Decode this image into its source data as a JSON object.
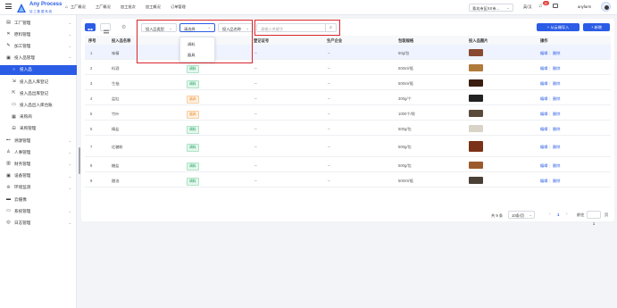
{
  "app": {
    "logo_title": "Any Process",
    "logo_sub": "加 工 数 据 系 统"
  },
  "topnav": {
    "items": [
      "工厂概况",
      "工厂概况",
      "加工批次",
      "加工概况",
      "订单管理"
    ],
    "factory_select": "青岛市区XX市…",
    "lang": "英/汉",
    "bell_count": "10",
    "user": "anyfarm"
  },
  "sidebar": {
    "items": [
      {
        "label": "工厂管理",
        "icon": "factory-icon",
        "chevron": "⌄"
      },
      {
        "label": "原料管理",
        "icon": "close-x-icon",
        "chevron": "⌄"
      },
      {
        "label": "加工管理",
        "icon": "tools-icon",
        "chevron": "⌄"
      },
      {
        "label": "投入品管理",
        "icon": "box-icon",
        "chevron": "⌃"
      },
      {
        "label": "投入品",
        "icon": "circle-icon",
        "chevron": "",
        "sub": true,
        "active": true
      },
      {
        "label": "投入品入库登记",
        "icon": "inbound-icon",
        "chevron": "",
        "sub": true
      },
      {
        "label": "投入品出库登记",
        "icon": "outbound-icon",
        "chevron": "",
        "sub": true
      },
      {
        "label": "投入品出入库台账",
        "icon": "ledger-icon",
        "chevron": "",
        "sub": true
      },
      {
        "label": "采购商",
        "icon": "store-icon",
        "chevron": "",
        "sub": true
      },
      {
        "label": "采购管理",
        "icon": "cart-icon",
        "chevron": "",
        "sub": true
      },
      {
        "label": "溯源管理",
        "icon": "trace-icon",
        "chevron": "⌄"
      },
      {
        "label": "人事管理",
        "icon": "person-icon",
        "chevron": "⌄"
      },
      {
        "label": "财务管理",
        "icon": "finance-icon",
        "chevron": "⌄"
      },
      {
        "label": "设备管理",
        "icon": "device-icon",
        "chevron": "⌄"
      },
      {
        "label": "环境监测",
        "icon": "gear-icon",
        "chevron": "⌄"
      },
      {
        "label": "云摄像",
        "icon": "camera-icon",
        "chevron": ""
      },
      {
        "label": "系统管理",
        "icon": "monitor-icon",
        "chevron": "⌄"
      },
      {
        "label": "日志管理",
        "icon": "log-icon",
        "chevron": "⌄"
      }
    ]
  },
  "toolbar": {
    "type_select": "投入品类型",
    "value_select": "请选择",
    "name_select": "投入品名称",
    "search_placeholder": "请输入关键字",
    "import_btn": "+ 从云端导入",
    "add_btn": "+ 新增",
    "dropdown_options": [
      "调料",
      "器具"
    ]
  },
  "table": {
    "headers": [
      "序号",
      "投入品名称",
      "",
      "登记证号",
      "生产企业",
      "包装规格",
      "投入品图片",
      "操作"
    ],
    "rows": [
      {
        "no": "1",
        "name": "味精",
        "tag": "调料",
        "tag_color": "green",
        "reg": "--",
        "maker": "--",
        "spec": "50g/包",
        "img": "#8a4a32"
      },
      {
        "no": "2",
        "name": "料酒",
        "tag": "调料",
        "tag_color": "green",
        "reg": "--",
        "maker": "--",
        "spec": "500ml/瓶",
        "img": "#b07a3a"
      },
      {
        "no": "3",
        "name": "生抽",
        "tag": "调料",
        "tag_color": "green",
        "reg": "--",
        "maker": "--",
        "spec": "500ml/瓶",
        "img": "#3a1d10"
      },
      {
        "no": "4",
        "name": "盆缸",
        "tag": "器具",
        "tag_color": "orange",
        "reg": "--",
        "maker": "--",
        "spec": "300g/个",
        "img": "#222222"
      },
      {
        "no": "5",
        "name": "竹叶",
        "tag": "器具",
        "tag_color": "orange",
        "reg": "--",
        "maker": "--",
        "spec": "1000个/袋",
        "img": "#5a4a3c"
      },
      {
        "no": "6",
        "name": "精盐",
        "tag": "调料",
        "tag_color": "green",
        "reg": "--",
        "maker": "--",
        "spec": "500g/包",
        "img": "#d9d3c8"
      },
      {
        "no": "7",
        "name": "红糖粉",
        "tag": "调料",
        "tag_color": "green",
        "reg": "--",
        "maker": "--",
        "spec": "500g/包",
        "img": "#7a3218"
      },
      {
        "no": "8",
        "name": "糖盐",
        "tag": "调料",
        "tag_color": "green",
        "reg": "--",
        "maker": "--",
        "spec": "500g/包",
        "img": "#9b5a2c"
      },
      {
        "no": "9",
        "name": "醋油",
        "tag": "调料",
        "tag_color": "green",
        "reg": "--",
        "maker": "--",
        "spec": "500ml/瓶",
        "img": "#4a4036"
      }
    ],
    "edit": "编辑",
    "delete": "删除"
  },
  "pager": {
    "total": "共 9 条",
    "size": "10条/页",
    "page": "1",
    "goto_label": "前往",
    "goto_value": "1",
    "page_suffix": "页"
  }
}
